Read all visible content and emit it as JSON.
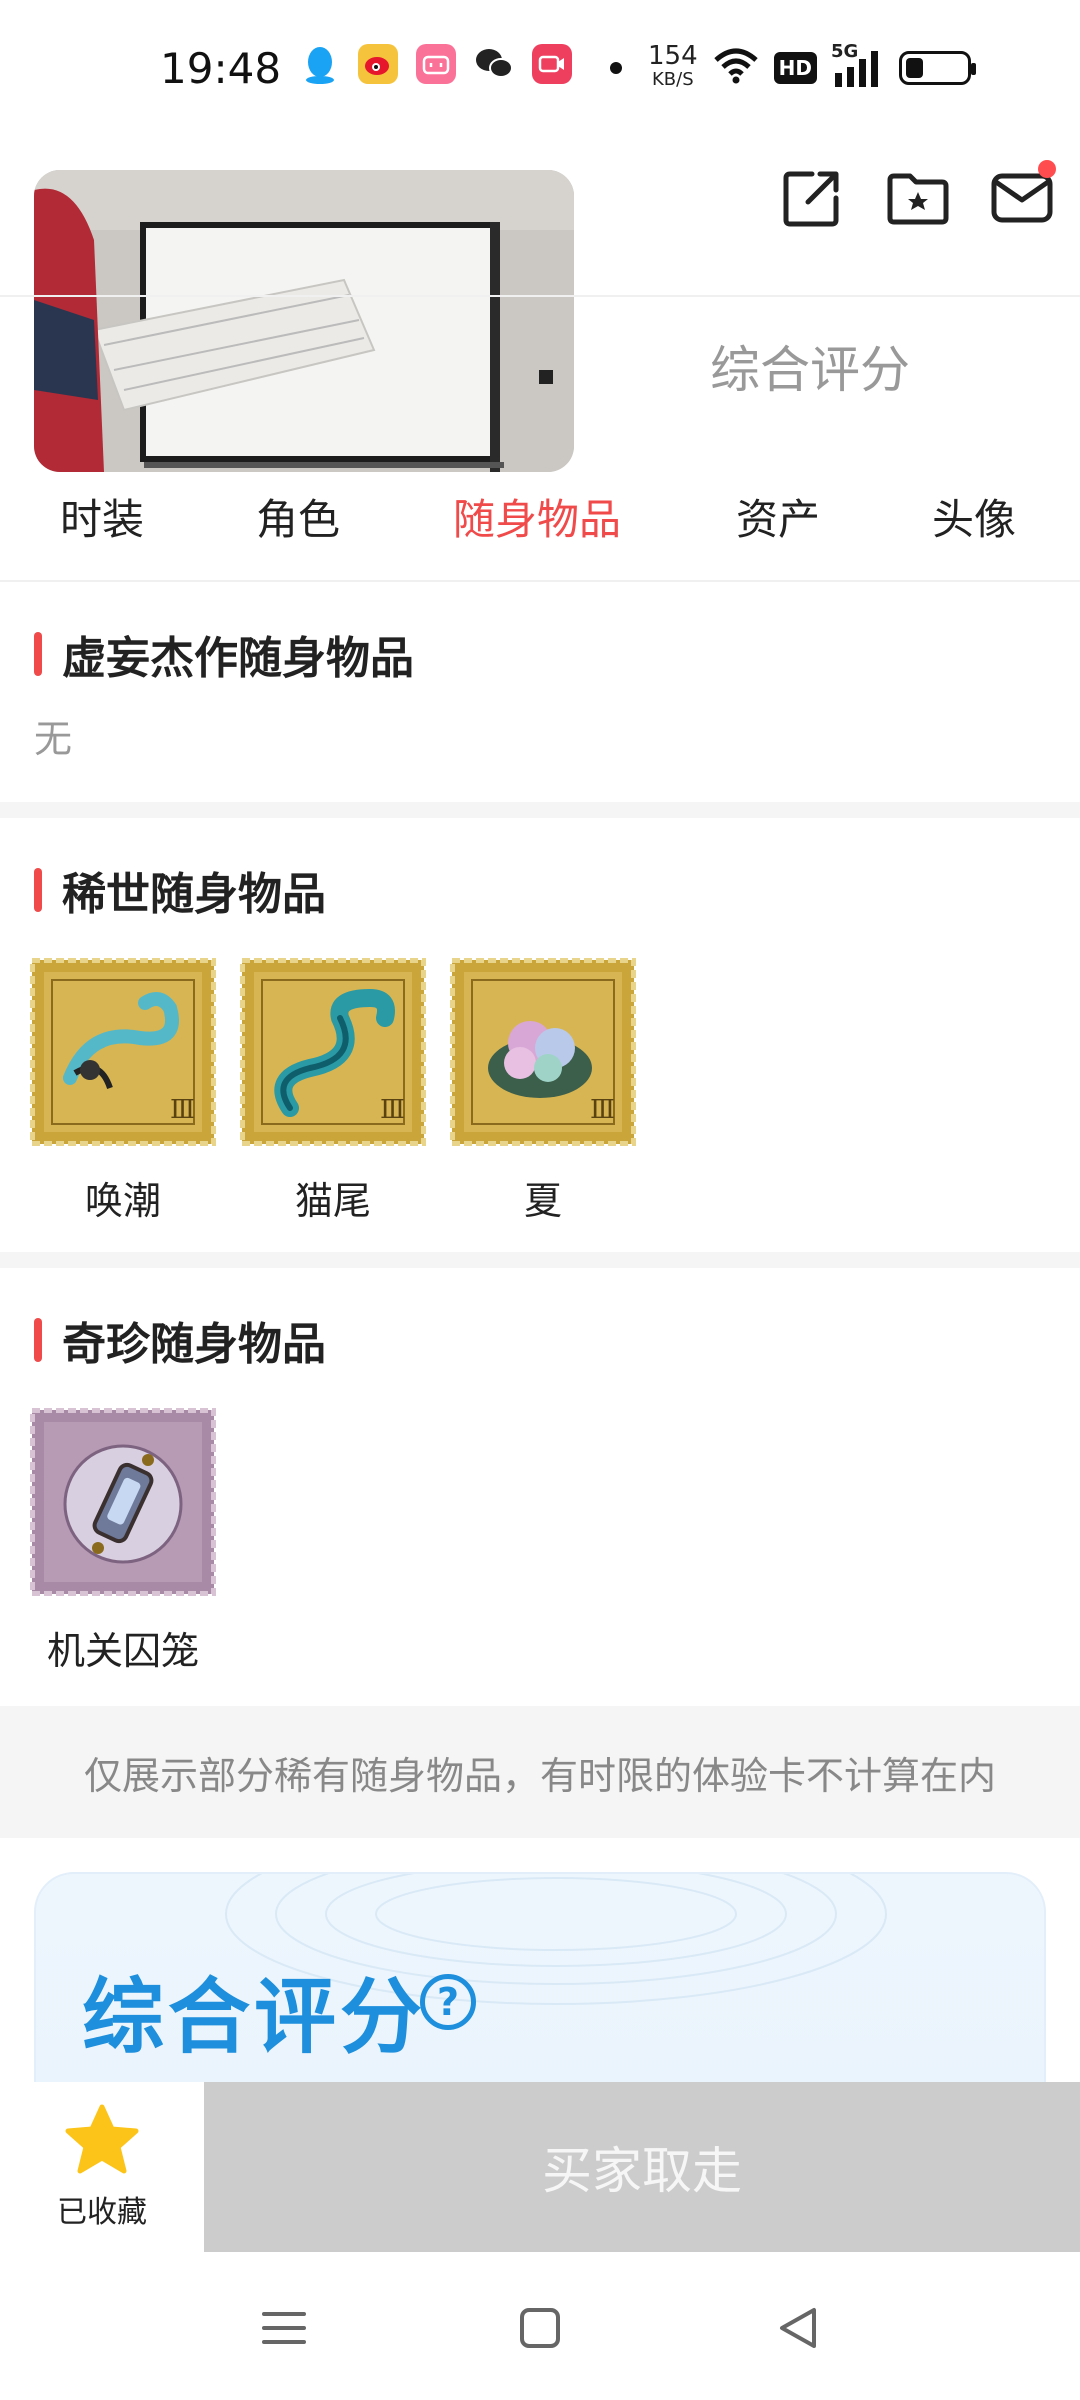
{
  "status_bar": {
    "time": "19:48",
    "net_speed_value": "154",
    "net_speed_unit": "KB/S",
    "hd_label": "HD",
    "signal_label": "5G",
    "battery_level": 0.3
  },
  "tabs_upper": {
    "score_tab": "综合评分"
  },
  "sub_tabs": [
    "时装",
    "角色",
    "随身物品",
    "资产",
    "头像"
  ],
  "active_sub_tab": 2,
  "sections": {
    "legendary": {
      "title": "虚妄杰作随身物品",
      "empty_text": "无"
    },
    "rare": {
      "title": "稀世随身物品",
      "items": [
        "唤潮",
        "猫尾",
        "夏"
      ]
    },
    "treasure": {
      "title": "奇珍随身物品",
      "items": [
        "机关囚笼"
      ]
    }
  },
  "notice": "仅展示部分稀有随身物品，有时限的体验卡不计算在内",
  "score_card": {
    "title": "综合评分",
    "help_icon": "?"
  },
  "bottom_bar": {
    "favorite_label": "已收藏",
    "buy_label": "买家取走"
  },
  "colors": {
    "accent_red": "#f04a4a",
    "score_blue": "#1e8fdc",
    "star_yellow": "#fcc419",
    "gold_stamp": "#c9a53a",
    "purple_stamp": "#a98aa6"
  }
}
